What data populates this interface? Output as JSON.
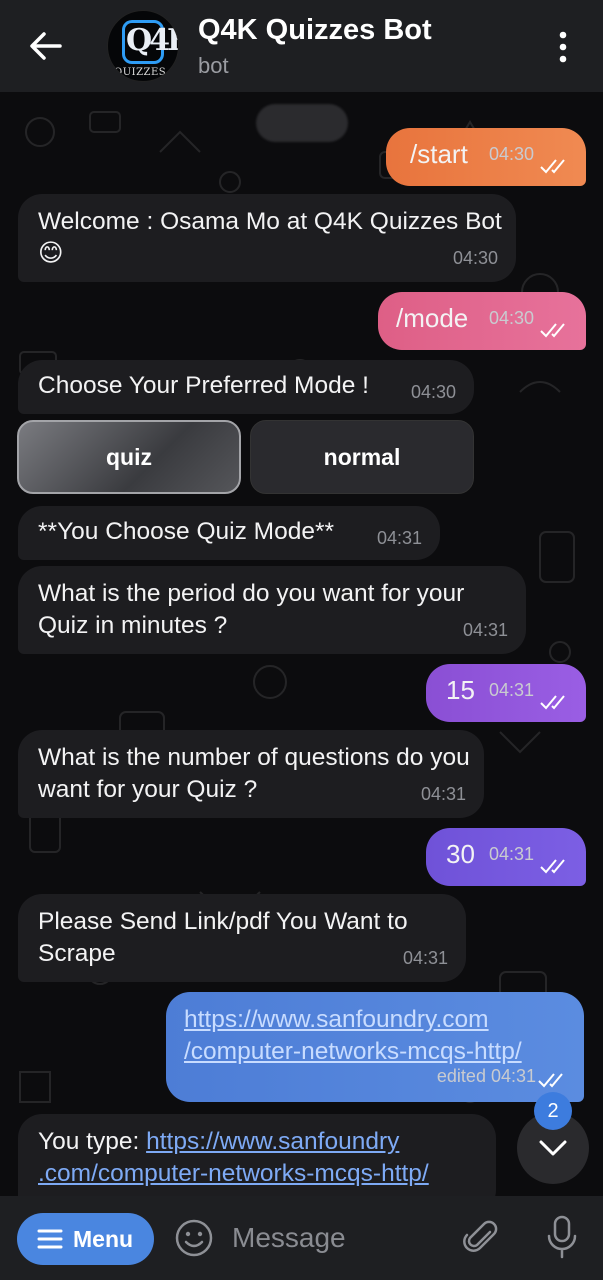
{
  "header": {
    "title": "Q4K Quizzes Bot",
    "subtitle": "bot",
    "avatar_logo_text": "Q4K",
    "avatar_logo_sub": "QUIZZES"
  },
  "messages": {
    "m1": {
      "text": "/start",
      "time": "04:30"
    },
    "m2": {
      "text": "Welcome : Osama  Mo at Q4K Quizzes Bot 😊",
      "time": "04:30"
    },
    "m3": {
      "text": "/mode",
      "time": "04:30"
    },
    "m4": {
      "text": "Choose Your Preferred Mode !",
      "time": "04:30"
    },
    "m5": {
      "text": "**You Choose Quiz Mode**",
      "time": "04:31"
    },
    "m6": {
      "text": "What is the period do you want for your Quiz in minutes ?",
      "time": "04:31"
    },
    "m7": {
      "text": "15",
      "time": "04:31"
    },
    "m8": {
      "text": "What is the number of questions do you want for your Quiz ?",
      "time": "04:31"
    },
    "m9": {
      "text": "30",
      "time": "04:31"
    },
    "m10": {
      "text": "Please Send Link/pdf You Want to Scrape",
      "time": "04:31"
    },
    "m11": {
      "link_line1": "https://www.sanfoundry.com",
      "link_line2": "/computer-networks-mcqs-http/",
      "time": "edited 04:31"
    },
    "m12": {
      "prefix": "You type: ",
      "link_line1": "https://www.sanfoundry",
      "link_line2": ".com/computer-networks-mcqs-http/"
    }
  },
  "keyboard": {
    "quiz": "quiz",
    "normal": "normal"
  },
  "unread_badge": "2",
  "bottom_bar": {
    "menu_label": "Menu",
    "input_placeholder": "Message"
  },
  "colors": {
    "header_bg": "#1e1f22",
    "incoming_bubble": "#1d1d20",
    "accent_blue": "#4a86e0"
  }
}
